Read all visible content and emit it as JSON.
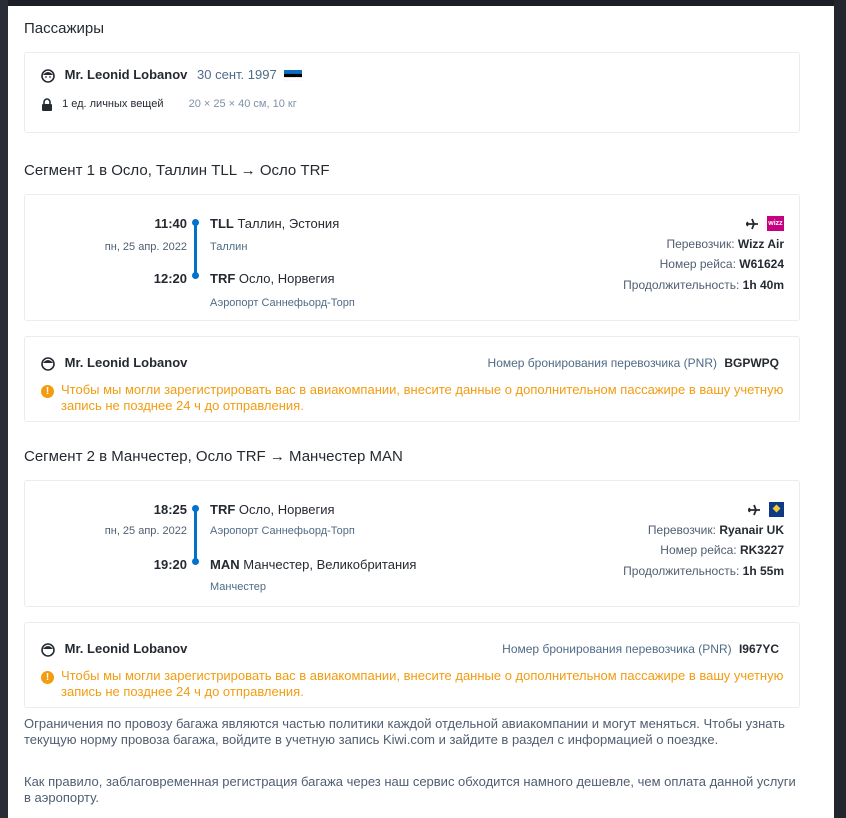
{
  "passengers": {
    "heading": "Пассажиры",
    "name": "Mr. Leonid Lobanov",
    "dob": "30 сент. 1997",
    "baggage_label": "1 ед. личных вещей",
    "baggage_size": "20 × 25 × 40 см, 10 кг"
  },
  "segments": [
    {
      "heading": "Сегмент 1 в Осло, Таллин TLL → Осло TRF",
      "dep_time": "11:40",
      "dep_date": "пн, 25 апр. 2022",
      "dep_code": "TLL",
      "dep_city": "Таллин, Эстония",
      "dep_airport": "Таллин",
      "arr_time": "12:20",
      "arr_code": "TRF",
      "arr_city": "Осло, Норвегия",
      "arr_airport": "Аэропорт Саннефьорд-Торп",
      "carrier_label": "Перевозчик:",
      "carrier": "Wizz Air",
      "carrier_logo": "wizz",
      "flight_label": "Номер рейса:",
      "flight": "W61624",
      "duration_label": "Продолжительность:",
      "duration": "1h 40m",
      "pax_name": "Mr. Leonid Lobanov",
      "pnr_label": "Номер бронирования перевозчика (PNR)",
      "pnr": "BGPWPQ",
      "warning": "Чтобы мы могли зарегистрировать вас в авиакомпании, внесите данные о дополнительном пассажире в вашу учетную запись не позднее 24 ч до отправления."
    },
    {
      "heading": "Сегмент 2 в Манчестер, Осло TRF → Манчестер MAN",
      "dep_time": "18:25",
      "dep_date": "пн, 25 апр. 2022",
      "dep_code": "TRF",
      "dep_city": "Осло, Норвегия",
      "dep_airport": "Аэропорт Саннефьорд-Торп",
      "arr_time": "19:20",
      "arr_code": "MAN",
      "arr_city": "Манчестер, Великобритания",
      "arr_airport": "Манчестер",
      "carrier_label": "Перевозчик:",
      "carrier": "Ryanair UK",
      "carrier_logo": "ryanair",
      "flight_label": "Номер рейса:",
      "flight": "RK3227",
      "duration_label": "Продолжительность:",
      "duration": "1h 55m",
      "pax_name": "Mr. Leonid Lobanov",
      "pnr_label": "Номер бронирования перевозчика (PNR)",
      "pnr": "I967YC",
      "warning": "Чтобы мы могли зарегистрировать вас в авиакомпании, внесите данные о дополнительном пассажире в вашу учетную запись не позднее 24 ч до отправления."
    }
  ],
  "notes": [
    "Ограничения по провозу багажа являются частью политики каждой отдельной авиакомпании и могут меняться. Чтобы узнать текущую норму провоза багажа, войдите в учетную запись Kiwi.com и зайдите в раздел с информацией о поездке.",
    "Как правило, заблаговременная регистрация багажа через наш сервис обходится намного дешевле, чем оплата данной услуги в аэропорту."
  ],
  "colors": {
    "accent": "#0172cb",
    "warning": "#f29c12",
    "wizz": "#c6007e",
    "ryanair": "#0d3a83"
  }
}
